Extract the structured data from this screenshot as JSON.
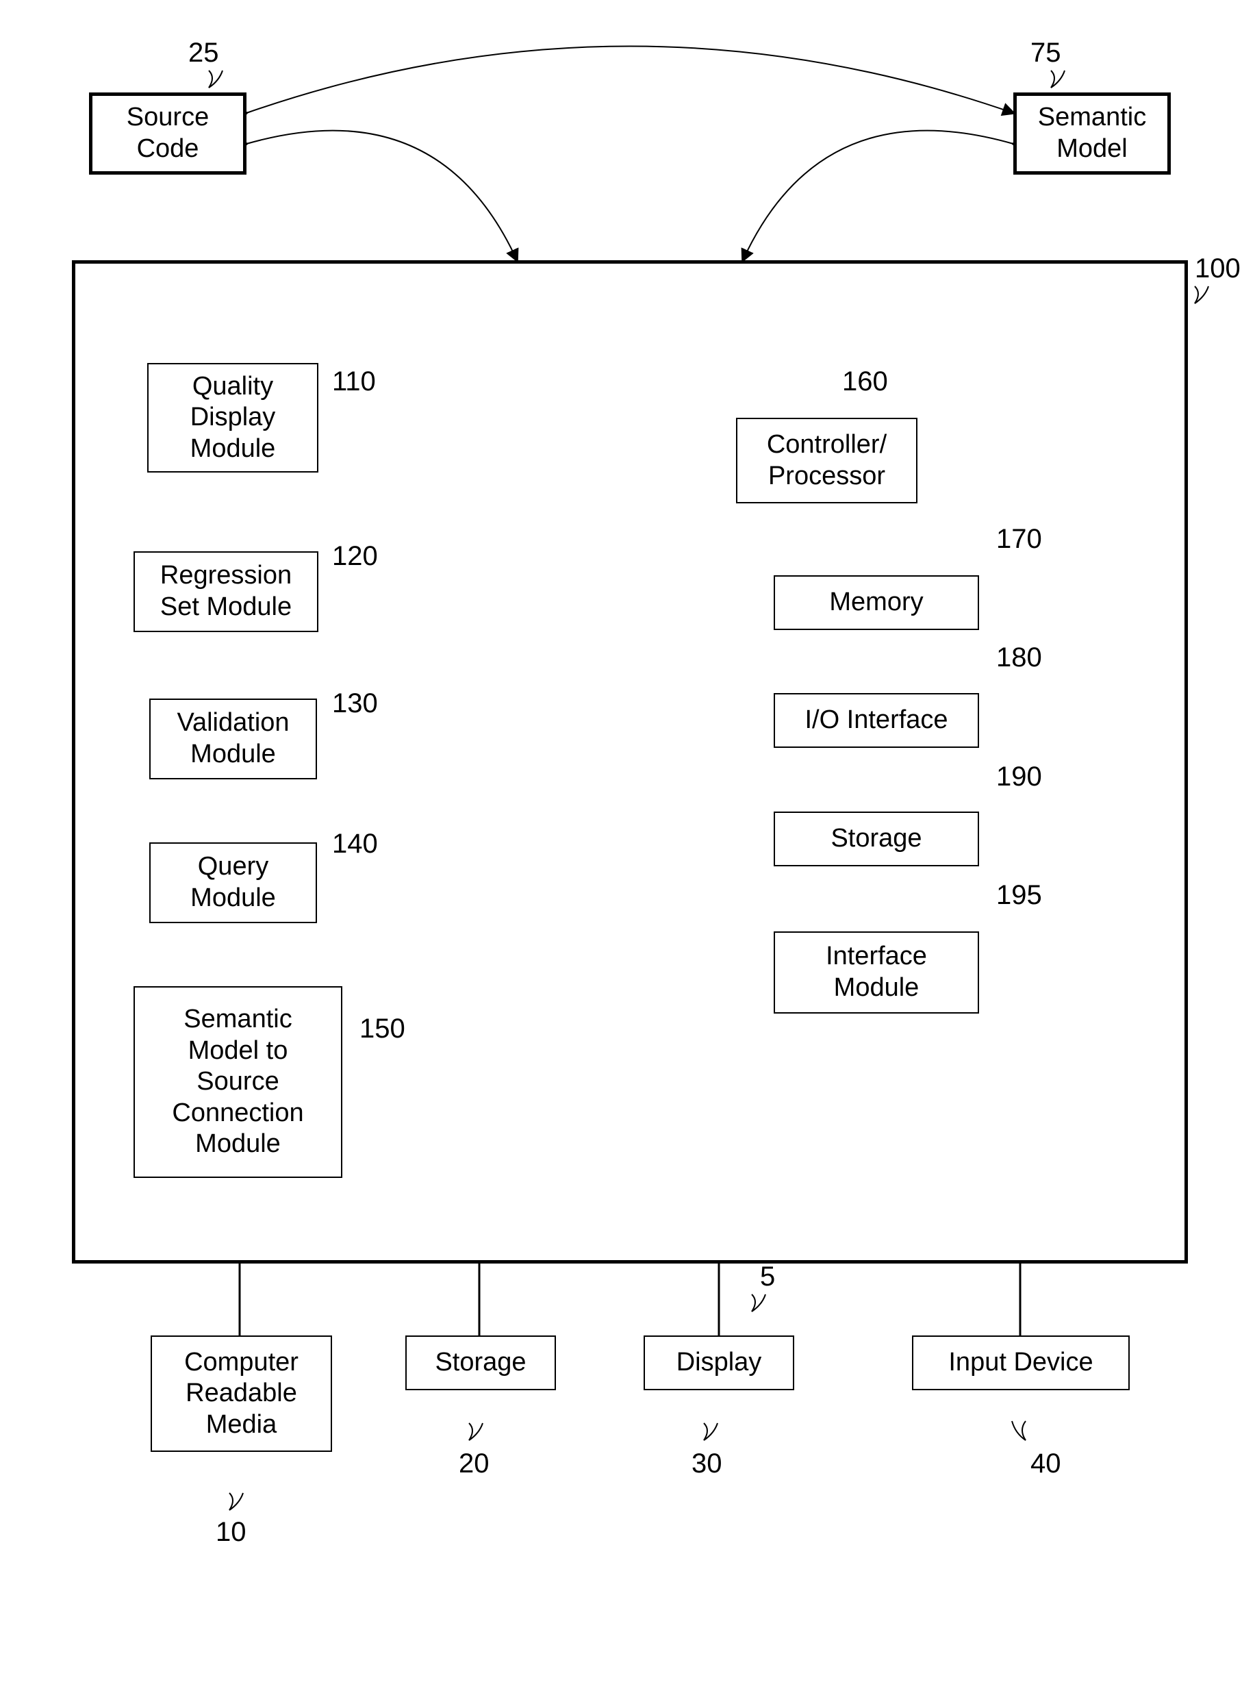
{
  "topBoxes": {
    "sourceCode": {
      "label": "Source\nCode",
      "ref": "25"
    },
    "semanticModel": {
      "label": "Semantic\nModel",
      "ref": "75"
    }
  },
  "mainContainer": {
    "ref": "100"
  },
  "leftModules": [
    {
      "label": "Quality\nDisplay\nModule",
      "ref": "110"
    },
    {
      "label": "Regression\nSet Module",
      "ref": "120"
    },
    {
      "label": "Validation\nModule",
      "ref": "130"
    },
    {
      "label": "Query\nModule",
      "ref": "140"
    },
    {
      "label": "Semantic\nModel to\nSource\nConnection\nModule",
      "ref": "150"
    }
  ],
  "rightComponents": [
    {
      "label": "Controller/\nProcessor",
      "ref": "160"
    },
    {
      "label": "Memory",
      "ref": "170"
    },
    {
      "label": "I/O Interface",
      "ref": "180"
    },
    {
      "label": "Storage",
      "ref": "190"
    },
    {
      "label": "Interface\nModule",
      "ref": "195"
    }
  ],
  "bottomBoxes": [
    {
      "label": "Computer\nReadable\nMedia",
      "ref": "10"
    },
    {
      "label": "Storage",
      "ref": "20"
    },
    {
      "label": "Display",
      "ref": "30"
    },
    {
      "label": "Input Device",
      "ref": "40"
    }
  ],
  "globalRef": "5"
}
